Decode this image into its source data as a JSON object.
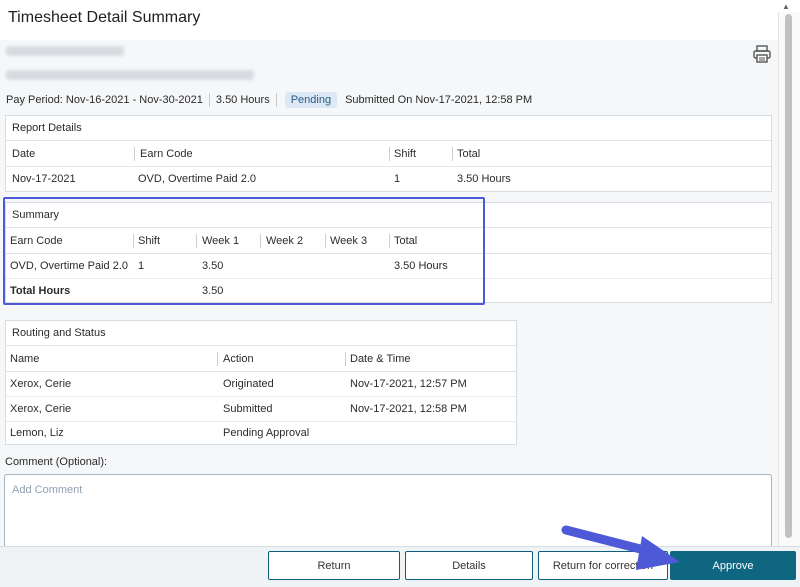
{
  "header": {
    "title": "Timesheet Detail Summary"
  },
  "pay_info": {
    "pay_period": "Pay Period: Nov-16-2021 - Nov-30-2021",
    "hours": "3.50 Hours",
    "status": "Pending",
    "submitted": "Submitted On Nov-17-2021, 12:58 PM"
  },
  "report_details": {
    "title": "Report Details",
    "columns": [
      "Date",
      "Earn Code",
      "Shift",
      "Total"
    ],
    "rows": [
      {
        "date": "Nov-17-2021",
        "earn_code": "OVD, Overtime Paid 2.0",
        "shift": "1",
        "total": "3.50 Hours"
      }
    ]
  },
  "summary": {
    "title": "Summary",
    "columns": [
      "Earn Code",
      "Shift",
      "Week 1",
      "Week 2",
      "Week 3",
      "Total"
    ],
    "rows": [
      {
        "earn_code": "OVD, Overtime Paid 2.0",
        "shift": "1",
        "week1": "3.50",
        "week2": "",
        "week3": "",
        "total": "3.50 Hours"
      }
    ],
    "total_row": {
      "label": "Total Hours",
      "week1": "3.50"
    }
  },
  "routing": {
    "title": "Routing and Status",
    "columns": [
      "Name",
      "Action",
      "Date & Time"
    ],
    "rows": [
      {
        "name": "Xerox, Cerie",
        "action": "Originated",
        "datetime": "Nov-17-2021, 12:57 PM"
      },
      {
        "name": "Xerox, Cerie",
        "action": "Submitted",
        "datetime": "Nov-17-2021, 12:58 PM"
      },
      {
        "name": "Lemon, Liz",
        "action": "Pending Approval",
        "datetime": ""
      }
    ]
  },
  "comment": {
    "label": "Comment (Optional):",
    "placeholder": "Add Comment",
    "value": ""
  },
  "footer": {
    "return_label": "Return",
    "details_label": "Details",
    "return_correction_label": "Return for correction",
    "approve_label": "Approve"
  },
  "colors": {
    "accent": "#0f6680",
    "highlight": "#4e59d8",
    "badge_bg": "#dce8f3",
    "arrow": "#4e59d8"
  },
  "icons": {
    "print": "printer-icon"
  }
}
